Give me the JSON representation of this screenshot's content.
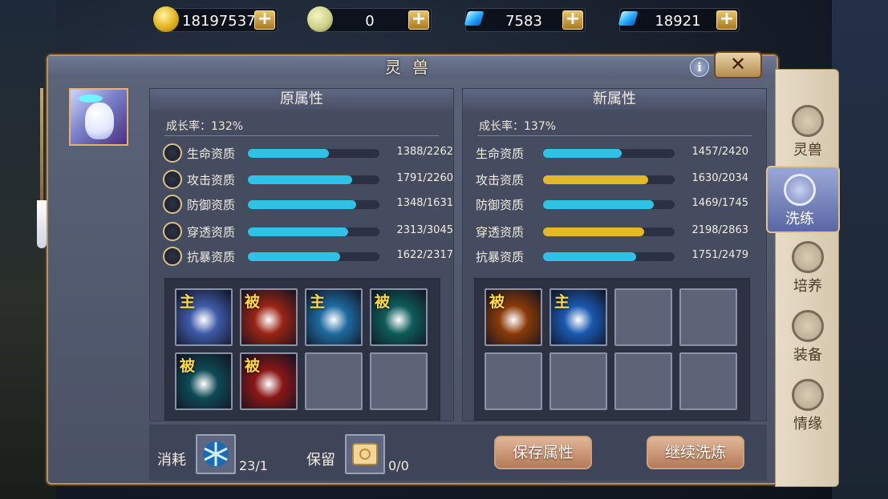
{
  "currencies": [
    {
      "icon": "gold-coin-icon",
      "value": "18197537"
    },
    {
      "icon": "jade-coin-icon",
      "value": "0"
    },
    {
      "icon": "blue-crystal-icon",
      "value": "7583"
    },
    {
      "icon": "diamond-icon",
      "value": "18921"
    }
  ],
  "window": {
    "title": "灵兽",
    "close_label": "✕",
    "info_label": "i"
  },
  "original": {
    "header": "原属性",
    "growth": "成长率：132%",
    "stats": [
      {
        "name": "生命资质",
        "value": "1388/2262",
        "ratio": 0.614,
        "color": "#2fc2e6"
      },
      {
        "name": "攻击资质",
        "value": "1791/2260",
        "ratio": 0.792,
        "color": "#2fc2e6"
      },
      {
        "name": "防御资质",
        "value": "1348/1631",
        "ratio": 0.826,
        "color": "#2fc2e6"
      },
      {
        "name": "穿透资质",
        "value": "2313/3045",
        "ratio": 0.76,
        "color": "#2fc2e6"
      },
      {
        "name": "抗暴资质",
        "value": "1622/2317",
        "ratio": 0.7,
        "color": "#2fc2e6"
      }
    ],
    "skills": [
      {
        "tag": "主",
        "name": "light-burst-skill-icon",
        "bg": "#3f5aa8"
      },
      {
        "tag": "被",
        "name": "fire-warrior-skill-icon",
        "bg": "#9a2414"
      },
      {
        "tag": "主",
        "name": "ice-crystal-skill-icon",
        "bg": "#1e6aa0"
      },
      {
        "tag": "被",
        "name": "teal-shield-skill-icon",
        "bg": "#0e5c5a"
      },
      {
        "tag": "被",
        "name": "spiral-shield-skill-icon",
        "bg": "#0e4a55"
      },
      {
        "tag": "被",
        "name": "red-crystal-skill-icon",
        "bg": "#8a1616"
      },
      {
        "tag": "",
        "name": "empty-skill-slot",
        "bg": ""
      },
      {
        "tag": "",
        "name": "empty-skill-slot",
        "bg": ""
      }
    ]
  },
  "new": {
    "header": "新属性",
    "growth": "成长率：137%",
    "stats": [
      {
        "name": "生命资质",
        "value": "1457/2420",
        "ratio": 0.6,
        "color": "#2fc2e6"
      },
      {
        "name": "攻击资质",
        "value": "1630/2034",
        "ratio": 0.8,
        "color": "#e3b928"
      },
      {
        "name": "防御资质",
        "value": "1469/1745",
        "ratio": 0.84,
        "color": "#2fc2e6"
      },
      {
        "name": "穿透资质",
        "value": "2198/2863",
        "ratio": 0.77,
        "color": "#e3b928"
      },
      {
        "name": "抗暴资质",
        "value": "1751/2479",
        "ratio": 0.71,
        "color": "#2fc2e6"
      }
    ],
    "skills": [
      {
        "tag": "被",
        "name": "paw-print-skill-icon",
        "bg": "#8a3a08"
      },
      {
        "tag": "主",
        "name": "blue-vortex-skill-icon",
        "bg": "#1a58b0"
      },
      {
        "tag": "",
        "name": "empty-skill-slot",
        "bg": ""
      },
      {
        "tag": "",
        "name": "empty-skill-slot",
        "bg": ""
      },
      {
        "tag": "",
        "name": "empty-skill-slot",
        "bg": ""
      },
      {
        "tag": "",
        "name": "empty-skill-slot",
        "bg": ""
      },
      {
        "tag": "",
        "name": "empty-skill-slot",
        "bg": ""
      },
      {
        "tag": "",
        "name": "empty-skill-slot",
        "bg": ""
      }
    ]
  },
  "bottom": {
    "consume_label": "消耗",
    "consume_count": "23/1",
    "keep_label": "保留",
    "keep_count": "0/0",
    "save_button": "保存属性",
    "continue_button": "继续洗炼"
  },
  "tabs": [
    {
      "label": "灵兽",
      "icon": "spirit-beast-icon",
      "active": false
    },
    {
      "label": "洗练",
      "icon": "refine-icon",
      "active": true
    },
    {
      "label": "培养",
      "icon": "cultivate-icon",
      "active": false
    },
    {
      "label": "装备",
      "icon": "equipment-icon",
      "active": false
    },
    {
      "label": "情缘",
      "icon": "bond-icon",
      "active": false
    }
  ]
}
